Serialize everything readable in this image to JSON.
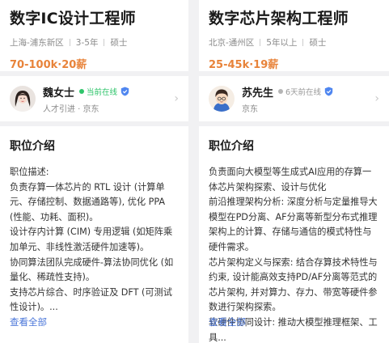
{
  "jobs": [
    {
      "title": "数字IC设计工程师",
      "location": "上海-浦东新区",
      "experience": "3-5年",
      "education": "硕士",
      "salary": "70-100k·20薪",
      "recruiter": {
        "name": "魏女士",
        "status": "当前在线",
        "status_color": "#2ec46a",
        "subtitle": "人才引进 · 京东"
      },
      "section_title": "职位介绍",
      "description": [
        "职位描述:",
        "负责存算一体芯片的 RTL 设计 (计算单元、存储控制、数据通路等), 优化 PPA (性能、功耗、面积)。",
        "设计存内计算 (CIM) 专用逻辑 (如矩阵乘加单元、非线性激活硬件加速等)。",
        "协同算法团队完成硬件-算法协同优化 (如量化、稀疏性支持)。",
        "支持芯片综合、时序验证及 DFT (可测试性设计)。..."
      ],
      "see_all": "查看全部"
    },
    {
      "title": "数字芯片架构工程师",
      "location": "北京-通州区",
      "experience": "5年以上",
      "education": "硕士",
      "salary": "25-45k·19薪",
      "recruiter": {
        "name": "苏先生",
        "status": "6天前在线",
        "status_color": "#b5b5b5",
        "subtitle": "京东"
      },
      "section_title": "职位介绍",
      "description": [
        "负责面向大模型等生成式AI应用的存算一体芯片架构探索、设计与优化",
        "前沿推理架构分析: 深度分析与定量推导大模型在PD分离、AF分离等新型分布式推理架构上的计算、存储与通信的模式特性与硬件需求。",
        "芯片架构定义与探索: 结合存算技术特性与约束, 设计能高效支持PD/AF分离等范式的芯片架构, 并对算力、存力、带宽等硬件参数进行架构探索。",
        "软硬件协同设计: 推动大模型推理框架、工具..."
      ],
      "see_all": "查看全部"
    }
  ],
  "colors": {
    "accent_salary": "#e8833a",
    "link": "#4a76d9",
    "verified": "#4f86f0"
  },
  "icons": [
    "female-avatar",
    "male-avatar",
    "verified-shield-icon",
    "chevron-right-icon"
  ]
}
